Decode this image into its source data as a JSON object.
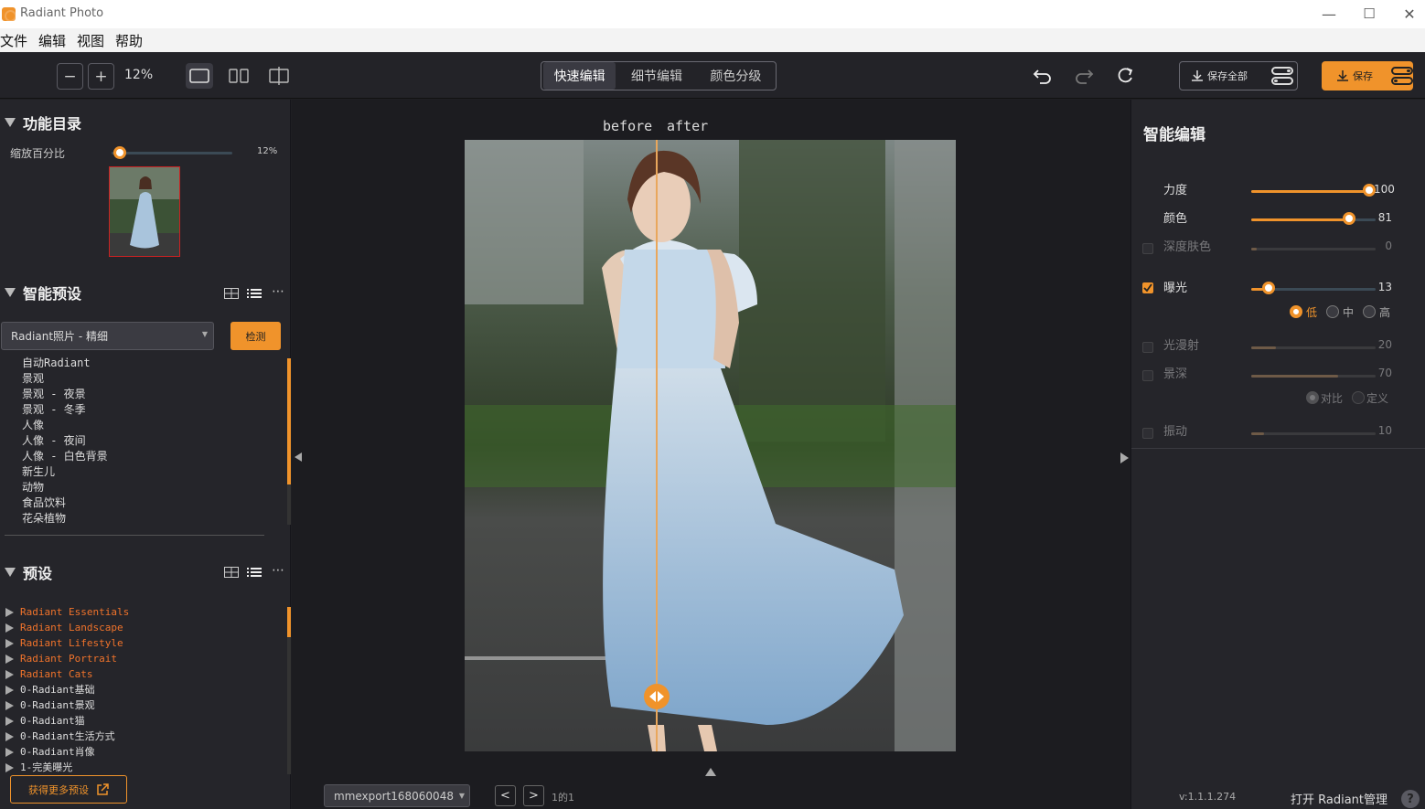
{
  "app": {
    "title": "Radiant Photo"
  },
  "window_controls": {
    "minimize": "—",
    "maximize": "☐",
    "close": "✕"
  },
  "menu": [
    "文件",
    "编辑",
    "视图",
    "帮助"
  ],
  "toolbar": {
    "zoom_out": "−",
    "zoom_in": "+",
    "zoom_level": "12%",
    "tabs": [
      {
        "label": "快速编辑",
        "active": true
      },
      {
        "label": "细节编辑",
        "active": false
      },
      {
        "label": "颜色分级",
        "active": false
      }
    ],
    "save_all_label": "保存全部",
    "save_label": "保存"
  },
  "left_panel": {
    "catalog": {
      "title": "功能目录",
      "zoom_label": "缩放百分比",
      "zoom_value": "12%",
      "zoom_fraction": 0.02
    },
    "smart_presets": {
      "title": "智能预设",
      "dropdown_value": "Radiant照片 - 精细",
      "detect_label": "检测",
      "items": [
        "自动Radiant",
        "景观",
        "景观 - 夜景",
        "景观 - 冬季",
        "人像",
        "人像 - 夜间",
        "人像 - 白色背景",
        "新生儿",
        "动物",
        "食品饮料",
        "花朵植物"
      ]
    },
    "presets": {
      "title": "预设",
      "items": [
        {
          "label": "Radiant Essentials",
          "highlight": true
        },
        {
          "label": "Radiant Landscape",
          "highlight": true
        },
        {
          "label": "Radiant Lifestyle",
          "highlight": true
        },
        {
          "label": "Radiant Portrait",
          "highlight": true
        },
        {
          "label": "Radiant Cats",
          "highlight": true
        },
        {
          "label": "0-Radiant基础",
          "highlight": false
        },
        {
          "label": "0-Radiant景观",
          "highlight": false
        },
        {
          "label": "0-Radiant猫",
          "highlight": false
        },
        {
          "label": "0-Radiant生活方式",
          "highlight": false
        },
        {
          "label": "0-Radiant肖像",
          "highlight": false
        },
        {
          "label": "1-完美曝光",
          "highlight": false
        }
      ],
      "more_label": "获得更多预设"
    }
  },
  "center": {
    "before_label": "before",
    "after_label": "after",
    "file_name": "mmexport168060048",
    "page_counter": "1的1",
    "prev": "<",
    "next": ">"
  },
  "right_panel": {
    "title": "智能编辑",
    "sliders": [
      {
        "id": "strength",
        "label": "力度",
        "value": "100",
        "fraction": 0.94,
        "checkbox": null,
        "enabled": true
      },
      {
        "id": "color",
        "label": "颜色",
        "value": "81",
        "fraction": 0.78,
        "checkbox": null,
        "enabled": true
      },
      {
        "id": "deep-skin",
        "label": "深度肤色",
        "value": "0",
        "fraction": 0.0,
        "checkbox": false,
        "enabled": false
      },
      {
        "id": "exposure",
        "label": "曝光",
        "value": "13",
        "fraction": 0.13,
        "checkbox": true,
        "enabled": true
      },
      {
        "id": "light-diffusion",
        "label": "光漫射",
        "value": "20",
        "fraction": 0.2,
        "checkbox": false,
        "enabled": false
      },
      {
        "id": "depth",
        "label": "景深",
        "value": "70",
        "fraction": 0.7,
        "checkbox": false,
        "enabled": false
      },
      {
        "id": "vibrance",
        "label": "振动",
        "value": "10",
        "fraction": 0.1,
        "checkbox": false,
        "enabled": false
      }
    ],
    "exposure_levels": [
      {
        "label": "低",
        "selected": true
      },
      {
        "label": "中",
        "selected": false
      },
      {
        "label": "高",
        "selected": false
      }
    ],
    "depth_modes": [
      {
        "label": "对比",
        "selected": true
      },
      {
        "label": "定义",
        "selected": false
      }
    ],
    "version": "v:1.1.1.274",
    "manage_label": "打开 Radiant管理",
    "help": "?"
  },
  "colors": {
    "accent": "#f0932b",
    "panel": "#25252a",
    "canvas": "#1c1c20"
  }
}
